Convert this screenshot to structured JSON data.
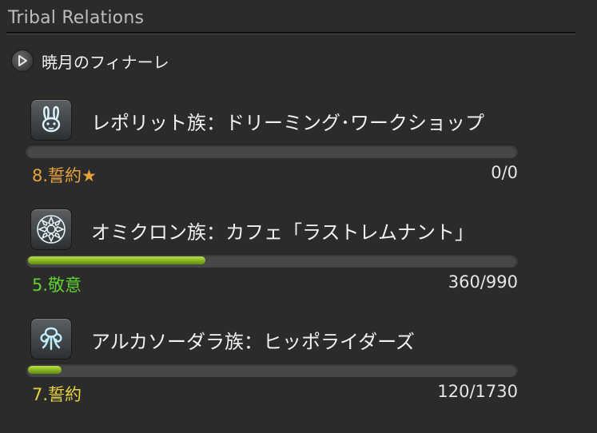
{
  "window": {
    "title": "Tribal Relations"
  },
  "section": {
    "label": "暁月のフィナーレ",
    "toggle_icon": "play-triangle-icon"
  },
  "tribes": [
    {
      "name": "レポリット族：ドリーミング･ワークショップ",
      "icon": "rabbit-icon",
      "rank": "8.誓約★",
      "rank_color": "#e8a23a",
      "count": "0/0",
      "progress": 0
    },
    {
      "name": "オミクロン族：カフェ「ラストレムナント」",
      "icon": "flower-emblem-icon",
      "rank": "5.敬意",
      "rank_color": "#5fd12f",
      "count": "360/990",
      "progress": 0.3636
    },
    {
      "name": "アルカソーダラ族：ヒッポライダーズ",
      "icon": "tentacle-emblem-icon",
      "rank": "7.誓約",
      "rank_color": "#e6d33c",
      "count": "120/1730",
      "progress": 0.0694
    }
  ],
  "colors": {
    "background": "#2b2b2b",
    "bar_fill": "#8fc12a",
    "bar_track": "#474747"
  }
}
